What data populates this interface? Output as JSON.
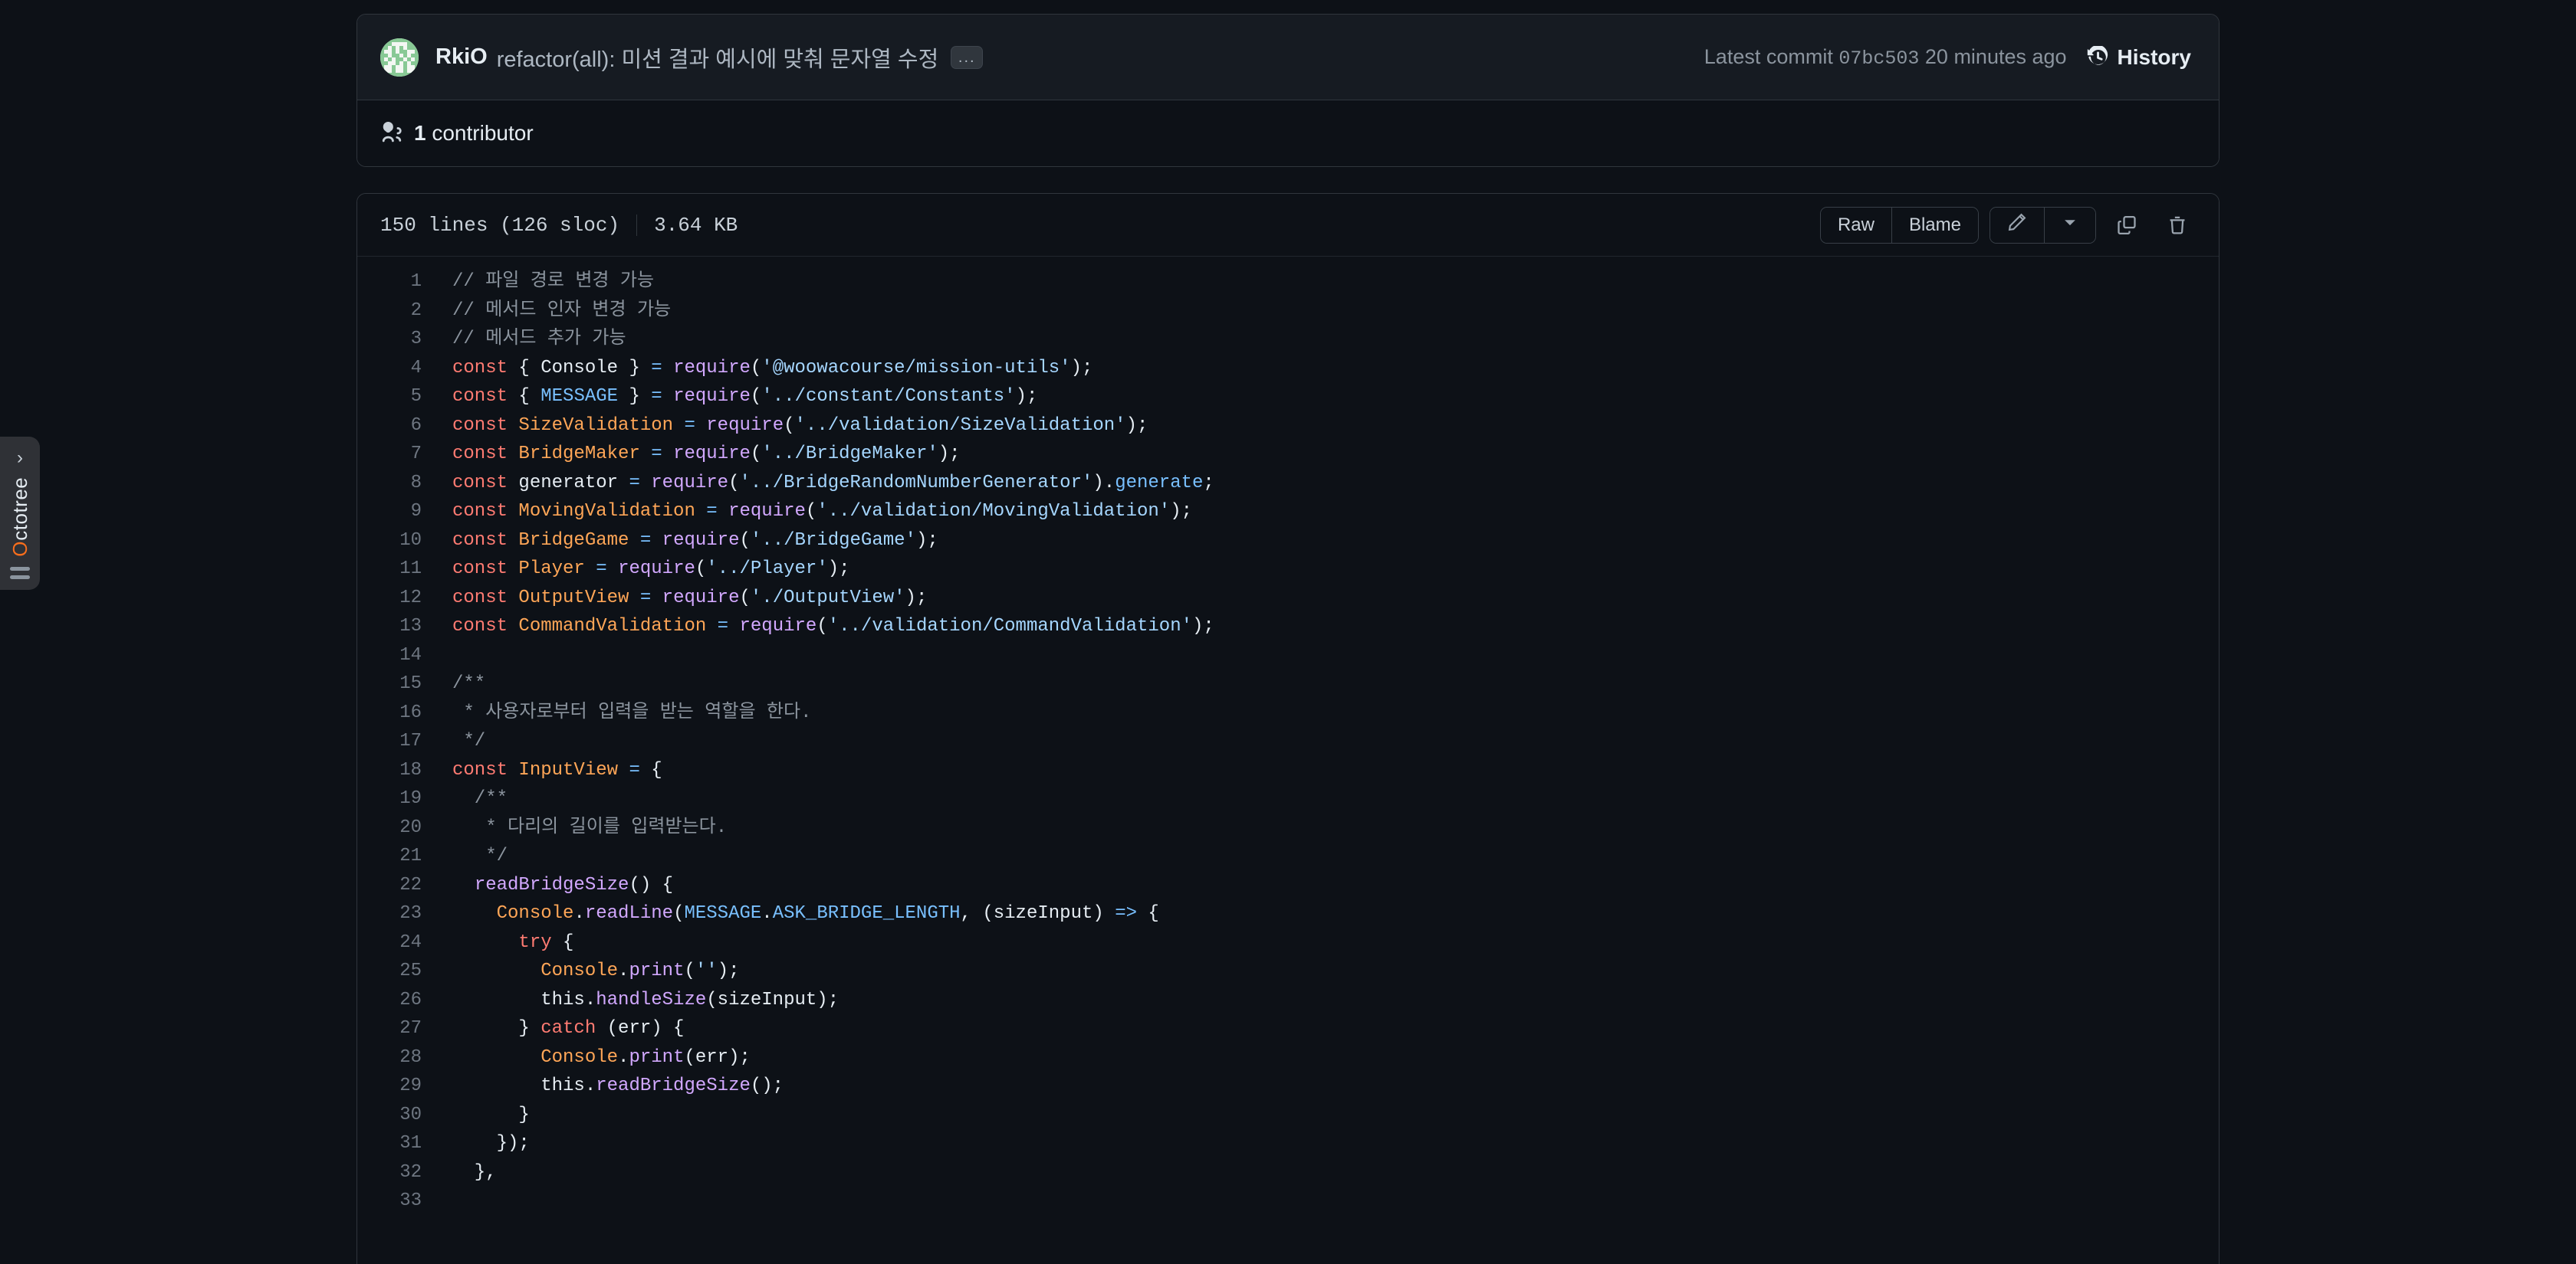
{
  "octotree": {
    "label_first": "O",
    "label_rest": "ctotree",
    "chevron_icon": "chevron-right-icon",
    "grip_icon": "drag-handle-icon"
  },
  "commit": {
    "avatar_icon": "user-avatar-identicon",
    "author": "RkiO",
    "message": "refactor(all): 미션 결과 예시에 맞춰 문자열 수정",
    "expand_label": "...",
    "latest_commit_prefix": "Latest commit",
    "sha": "07bc503",
    "time": "20 minutes ago",
    "history_label": "History",
    "history_icon": "history-clock-icon"
  },
  "contributors": {
    "icon": "people-icon",
    "count": "1",
    "label": "contributor"
  },
  "file_toolbar": {
    "lines": "150 lines (126 sloc)",
    "size": "3.64 KB",
    "raw_label": "Raw",
    "blame_label": "Blame",
    "edit_icon": "pencil-icon",
    "edit_dropdown_icon": "chevron-down-icon",
    "copy_icon": "copy-icon",
    "delete_icon": "trash-icon"
  },
  "code": {
    "language": "javascript",
    "lines": [
      {
        "n": "1",
        "tokens": [
          {
            "t": "com",
            "s": "// 파일 경로 변경 가능"
          }
        ]
      },
      {
        "n": "2",
        "tokens": [
          {
            "t": "com",
            "s": "// 메서드 인자 변경 가능"
          }
        ]
      },
      {
        "n": "3",
        "tokens": [
          {
            "t": "com",
            "s": "// 메서드 추가 가능"
          }
        ]
      },
      {
        "n": "4",
        "tokens": [
          {
            "t": "kw",
            "s": "const"
          },
          {
            "t": "pun",
            "s": " { Console } "
          },
          {
            "t": "op",
            "s": "="
          },
          {
            "t": "pun",
            "s": " "
          },
          {
            "t": "fn",
            "s": "require"
          },
          {
            "t": "pun",
            "s": "("
          },
          {
            "t": "str",
            "s": "'@woowacourse/mission-utils'"
          },
          {
            "t": "pun",
            "s": ");"
          }
        ]
      },
      {
        "n": "5",
        "tokens": [
          {
            "t": "kw",
            "s": "const"
          },
          {
            "t": "pun",
            "s": " { "
          },
          {
            "t": "var",
            "s": "MESSAGE"
          },
          {
            "t": "pun",
            "s": " } "
          },
          {
            "t": "op",
            "s": "="
          },
          {
            "t": "pun",
            "s": " "
          },
          {
            "t": "fn",
            "s": "require"
          },
          {
            "t": "pun",
            "s": "("
          },
          {
            "t": "str",
            "s": "'../constant/Constants'"
          },
          {
            "t": "pun",
            "s": ");"
          }
        ]
      },
      {
        "n": "6",
        "tokens": [
          {
            "t": "kw",
            "s": "const"
          },
          {
            "t": "pun",
            "s": " "
          },
          {
            "t": "cls",
            "s": "SizeValidation"
          },
          {
            "t": "pun",
            "s": " "
          },
          {
            "t": "op",
            "s": "="
          },
          {
            "t": "pun",
            "s": " "
          },
          {
            "t": "fn",
            "s": "require"
          },
          {
            "t": "pun",
            "s": "("
          },
          {
            "t": "str",
            "s": "'../validation/SizeValidation'"
          },
          {
            "t": "pun",
            "s": ");"
          }
        ]
      },
      {
        "n": "7",
        "tokens": [
          {
            "t": "kw",
            "s": "const"
          },
          {
            "t": "pun",
            "s": " "
          },
          {
            "t": "cls",
            "s": "BridgeMaker"
          },
          {
            "t": "pun",
            "s": " "
          },
          {
            "t": "op",
            "s": "="
          },
          {
            "t": "pun",
            "s": " "
          },
          {
            "t": "fn",
            "s": "require"
          },
          {
            "t": "pun",
            "s": "("
          },
          {
            "t": "str",
            "s": "'../BridgeMaker'"
          },
          {
            "t": "pun",
            "s": ");"
          }
        ]
      },
      {
        "n": "8",
        "tokens": [
          {
            "t": "kw",
            "s": "const"
          },
          {
            "t": "pun",
            "s": " generator "
          },
          {
            "t": "op",
            "s": "="
          },
          {
            "t": "pun",
            "s": " "
          },
          {
            "t": "fn",
            "s": "require"
          },
          {
            "t": "pun",
            "s": "("
          },
          {
            "t": "str",
            "s": "'../BridgeRandomNumberGenerator'"
          },
          {
            "t": "pun",
            "s": ")."
          },
          {
            "t": "var",
            "s": "generate"
          },
          {
            "t": "pun",
            "s": ";"
          }
        ]
      },
      {
        "n": "9",
        "tokens": [
          {
            "t": "kw",
            "s": "const"
          },
          {
            "t": "pun",
            "s": " "
          },
          {
            "t": "cls",
            "s": "MovingValidation"
          },
          {
            "t": "pun",
            "s": " "
          },
          {
            "t": "op",
            "s": "="
          },
          {
            "t": "pun",
            "s": " "
          },
          {
            "t": "fn",
            "s": "require"
          },
          {
            "t": "pun",
            "s": "("
          },
          {
            "t": "str",
            "s": "'../validation/MovingValidation'"
          },
          {
            "t": "pun",
            "s": ");"
          }
        ]
      },
      {
        "n": "10",
        "tokens": [
          {
            "t": "kw",
            "s": "const"
          },
          {
            "t": "pun",
            "s": " "
          },
          {
            "t": "cls",
            "s": "BridgeGame"
          },
          {
            "t": "pun",
            "s": " "
          },
          {
            "t": "op",
            "s": "="
          },
          {
            "t": "pun",
            "s": " "
          },
          {
            "t": "fn",
            "s": "require"
          },
          {
            "t": "pun",
            "s": "("
          },
          {
            "t": "str",
            "s": "'../BridgeGame'"
          },
          {
            "t": "pun",
            "s": ");"
          }
        ]
      },
      {
        "n": "11",
        "tokens": [
          {
            "t": "kw",
            "s": "const"
          },
          {
            "t": "pun",
            "s": " "
          },
          {
            "t": "cls",
            "s": "Player"
          },
          {
            "t": "pun",
            "s": " "
          },
          {
            "t": "op",
            "s": "="
          },
          {
            "t": "pun",
            "s": " "
          },
          {
            "t": "fn",
            "s": "require"
          },
          {
            "t": "pun",
            "s": "("
          },
          {
            "t": "str",
            "s": "'../Player'"
          },
          {
            "t": "pun",
            "s": ");"
          }
        ]
      },
      {
        "n": "12",
        "tokens": [
          {
            "t": "kw",
            "s": "const"
          },
          {
            "t": "pun",
            "s": " "
          },
          {
            "t": "cls",
            "s": "OutputView"
          },
          {
            "t": "pun",
            "s": " "
          },
          {
            "t": "op",
            "s": "="
          },
          {
            "t": "pun",
            "s": " "
          },
          {
            "t": "fn",
            "s": "require"
          },
          {
            "t": "pun",
            "s": "("
          },
          {
            "t": "str",
            "s": "'./OutputView'"
          },
          {
            "t": "pun",
            "s": ");"
          }
        ]
      },
      {
        "n": "13",
        "tokens": [
          {
            "t": "kw",
            "s": "const"
          },
          {
            "t": "pun",
            "s": " "
          },
          {
            "t": "cls",
            "s": "CommandValidation"
          },
          {
            "t": "pun",
            "s": " "
          },
          {
            "t": "op",
            "s": "="
          },
          {
            "t": "pun",
            "s": " "
          },
          {
            "t": "fn",
            "s": "require"
          },
          {
            "t": "pun",
            "s": "("
          },
          {
            "t": "str",
            "s": "'../validation/CommandValidation'"
          },
          {
            "t": "pun",
            "s": ");"
          }
        ]
      },
      {
        "n": "14",
        "tokens": []
      },
      {
        "n": "15",
        "tokens": [
          {
            "t": "com",
            "s": "/**"
          }
        ]
      },
      {
        "n": "16",
        "tokens": [
          {
            "t": "com",
            "s": " * 사용자로부터 입력을 받는 역할을 한다."
          }
        ]
      },
      {
        "n": "17",
        "tokens": [
          {
            "t": "com",
            "s": " */"
          }
        ]
      },
      {
        "n": "18",
        "tokens": [
          {
            "t": "kw",
            "s": "const"
          },
          {
            "t": "pun",
            "s": " "
          },
          {
            "t": "cls",
            "s": "InputView"
          },
          {
            "t": "pun",
            "s": " "
          },
          {
            "t": "op",
            "s": "="
          },
          {
            "t": "pun",
            "s": " {"
          }
        ]
      },
      {
        "n": "19",
        "tokens": [
          {
            "t": "com",
            "s": "  /**"
          }
        ]
      },
      {
        "n": "20",
        "tokens": [
          {
            "t": "com",
            "s": "   * 다리의 길이를 입력받는다."
          }
        ]
      },
      {
        "n": "21",
        "tokens": [
          {
            "t": "com",
            "s": "   */"
          }
        ]
      },
      {
        "n": "22",
        "tokens": [
          {
            "t": "pun",
            "s": "  "
          },
          {
            "t": "fn",
            "s": "readBridgeSize"
          },
          {
            "t": "pun",
            "s": "() {"
          }
        ]
      },
      {
        "n": "23",
        "tokens": [
          {
            "t": "pun",
            "s": "    "
          },
          {
            "t": "cls",
            "s": "Console"
          },
          {
            "t": "pun",
            "s": "."
          },
          {
            "t": "fn",
            "s": "readLine"
          },
          {
            "t": "pun",
            "s": "("
          },
          {
            "t": "var",
            "s": "MESSAGE"
          },
          {
            "t": "pun",
            "s": "."
          },
          {
            "t": "var",
            "s": "ASK_BRIDGE_LENGTH"
          },
          {
            "t": "pun",
            "s": ", (sizeInput) "
          },
          {
            "t": "op",
            "s": "=>"
          },
          {
            "t": "pun",
            "s": " {"
          }
        ]
      },
      {
        "n": "24",
        "tokens": [
          {
            "t": "pun",
            "s": "      "
          },
          {
            "t": "kw",
            "s": "try"
          },
          {
            "t": "pun",
            "s": " {"
          }
        ]
      },
      {
        "n": "25",
        "tokens": [
          {
            "t": "pun",
            "s": "        "
          },
          {
            "t": "cls",
            "s": "Console"
          },
          {
            "t": "pun",
            "s": "."
          },
          {
            "t": "fn",
            "s": "print"
          },
          {
            "t": "pun",
            "s": "("
          },
          {
            "t": "str",
            "s": "''"
          },
          {
            "t": "pun",
            "s": ");"
          }
        ]
      },
      {
        "n": "26",
        "tokens": [
          {
            "t": "pun",
            "s": "        this."
          },
          {
            "t": "fn",
            "s": "handleSize"
          },
          {
            "t": "pun",
            "s": "(sizeInput);"
          }
        ]
      },
      {
        "n": "27",
        "tokens": [
          {
            "t": "pun",
            "s": "      } "
          },
          {
            "t": "kw",
            "s": "catch"
          },
          {
            "t": "pun",
            "s": " (err) {"
          }
        ]
      },
      {
        "n": "28",
        "tokens": [
          {
            "t": "pun",
            "s": "        "
          },
          {
            "t": "cls",
            "s": "Console"
          },
          {
            "t": "pun",
            "s": "."
          },
          {
            "t": "fn",
            "s": "print"
          },
          {
            "t": "pun",
            "s": "(err);"
          }
        ]
      },
      {
        "n": "29",
        "tokens": [
          {
            "t": "pun",
            "s": "        this."
          },
          {
            "t": "fn",
            "s": "readBridgeSize"
          },
          {
            "t": "pun",
            "s": "();"
          }
        ]
      },
      {
        "n": "30",
        "tokens": [
          {
            "t": "pun",
            "s": "      }"
          }
        ]
      },
      {
        "n": "31",
        "tokens": [
          {
            "t": "pun",
            "s": "    });"
          }
        ]
      },
      {
        "n": "32",
        "tokens": [
          {
            "t": "pun",
            "s": "  },"
          }
        ]
      },
      {
        "n": "33",
        "tokens": []
      }
    ]
  },
  "colors": {
    "page_bg": "#0d1117",
    "box_border": "#30363d",
    "header_bg": "#161b22",
    "text": "#e6edf3",
    "muted": "#8b949e",
    "octotree_accent": "#f96e1c",
    "keyword": "#ff7b72",
    "class": "#ffa657",
    "function": "#d2a8ff",
    "string": "#a5d6ff",
    "variable": "#79c0ff",
    "comment": "#8b949e"
  }
}
